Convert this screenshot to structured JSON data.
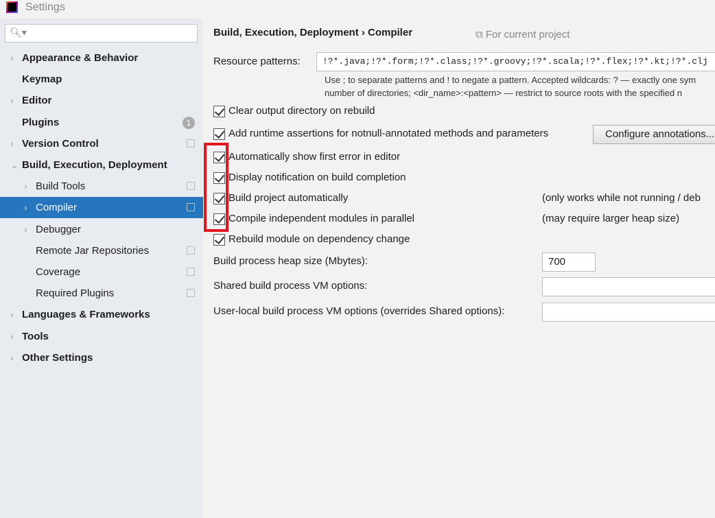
{
  "window": {
    "title": "Settings"
  },
  "sidebar": {
    "search_placeholder": "",
    "items": [
      {
        "label": "Appearance & Behavior",
        "chevron": "›"
      },
      {
        "label": "Keymap"
      },
      {
        "label": "Editor",
        "chevron": "›"
      },
      {
        "label": "Plugins",
        "badge": "1"
      },
      {
        "label": "Version Control",
        "chevron": "›"
      },
      {
        "label": "Build, Execution, Deployment",
        "chevron": "⌄"
      },
      {
        "label": "Build Tools",
        "chevron": "›"
      },
      {
        "label": "Compiler",
        "chevron": "›",
        "selected": true
      },
      {
        "label": "Debugger",
        "chevron": "›"
      },
      {
        "label": "Remote Jar Repositories"
      },
      {
        "label": "Coverage"
      },
      {
        "label": "Required Plugins"
      },
      {
        "label": "Languages & Frameworks",
        "chevron": "›"
      },
      {
        "label": "Tools",
        "chevron": "›"
      },
      {
        "label": "Other Settings",
        "chevron": "›"
      }
    ]
  },
  "main": {
    "breadcrumb": "Build, Execution, Deployment  ›  Compiler",
    "scope": "For current project",
    "resource_patterns_label": "Resource patterns:",
    "resource_patterns_value": "!?*.java;!?*.form;!?*.class;!?*.groovy;!?*.scala;!?*.flex;!?*.kt;!?*.clj",
    "hint_line1": "Use ; to separate patterns and ! to negate a pattern. Accepted wildcards: ? — exactly one sym",
    "hint_line2": "number of directories; <dir_name>:<pattern> — restrict to source roots with the specified n",
    "checkboxes": [
      {
        "label": "Clear output directory on rebuild",
        "checked": true
      },
      {
        "label": "Add runtime assertions for notnull-annotated methods and parameters",
        "checked": true
      },
      {
        "label": "Automatically show first error in editor",
        "checked": true
      },
      {
        "label": "Display notification on build completion",
        "checked": true
      },
      {
        "label": "Build project automatically",
        "checked": true,
        "note": "(only works while not running / deb"
      },
      {
        "label": "Compile independent modules in parallel",
        "checked": true,
        "note": "(may require larger heap size)"
      },
      {
        "label": "Rebuild module on dependency change",
        "checked": true
      }
    ],
    "configure_annotations": "Configure annotations...",
    "heap_label": "Build process heap size (Mbytes):",
    "heap_value": "700",
    "shared_vm_label": "Shared build process VM options:",
    "shared_vm_value": "",
    "user_vm_label": "User-local build process VM options (overrides Shared options):",
    "user_vm_value": ""
  },
  "colors": {
    "selection": "#2675bf",
    "highlight_box": "#e0191f"
  }
}
